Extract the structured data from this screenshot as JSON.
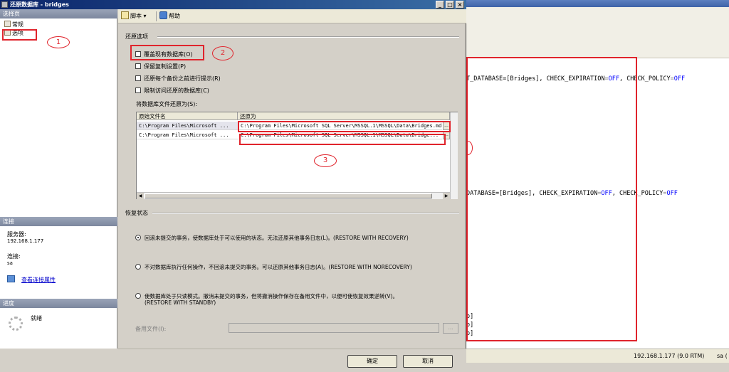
{
  "dialog": {
    "title": "还原数据库 - bridges",
    "minimize": "_",
    "maximize": "□",
    "close": "×"
  },
  "left_pane": {
    "select_page_header": "选择页",
    "pages": [
      {
        "label": "常规"
      },
      {
        "label": "选项"
      }
    ],
    "connection_header": "连接",
    "server_label": "服务器:",
    "server_value": "192.168.1.177",
    "connection_label": "连接:",
    "connection_value": "sa",
    "view_connection_link": "查看连接属性",
    "progress_header": "进度",
    "progress_status": "就绪"
  },
  "toolbar": {
    "script_label": "脚本",
    "script_arrow": "▾",
    "help_label": "帮助"
  },
  "restore_options": {
    "group_title": "还原选项",
    "checkboxes": [
      {
        "label": "覆盖现有数据库(O)",
        "checked": false
      },
      {
        "label": "保留复制设置(P)",
        "checked": false
      },
      {
        "label": "还原每个备份之前进行提示(R)",
        "checked": false
      },
      {
        "label": "限制访问还原的数据库(C)",
        "checked": false
      }
    ],
    "restore_files_label": "将数据库文件还原为(S):",
    "columns": [
      "原始文件名",
      "还原为"
    ],
    "rows": [
      {
        "original": "C:\\Program Files\\Microsoft ...",
        "restore_as": "C:\\Program Files\\Microsoft SQL Server\\MSSQL.1\\MSSQL\\Data\\Bridges.md"
      },
      {
        "original": "C:\\Program Files\\Microsoft ...",
        "restore_as": "C:\\Program Files\\Microsoft SQL Server\\MSSQL.1\\MSSQL\\Data\\Bridge..."
      }
    ],
    "browse_label": "..."
  },
  "recovery_state": {
    "group_title": "恢复状态",
    "options": [
      {
        "label": "回滚未提交的事务，使数据库处于可以使用的状态。无法还原其他事务日志(L)。(RESTORE WITH RECOVERY)",
        "line2": "",
        "selected": true
      },
      {
        "label": "不对数据库执行任何操作，不回滚未提交的事务。可以还原其他事务日志(A)。(RESTORE WITH NORECOVERY)",
        "line2": "",
        "selected": false
      },
      {
        "label": "使数据库处于只读模式。撤消未提交的事务，但将撤消操作保存在备用文件中，以便可使恢复效果逆转(V)。",
        "line2": "(RESTORE WITH STANDBY)",
        "selected": false
      }
    ],
    "standby_file_label": "备用文件(I):",
    "standby_file_value": "",
    "browse_label": "..."
  },
  "buttons": {
    "ok": "确定",
    "cancel": "取消"
  },
  "background_editor": {
    "lines": [
      {
        "pre": "T_DATABASE=[Bridges], CHECK_EXPIRATION",
        "eq": "=",
        "v1": "OFF",
        "mid": ", CHECK_POLICY",
        "eq2": "=",
        "v2": "OFF"
      },
      {
        "pre": "DATABASE=[Bridges], CHECK_EXPIRATION",
        "eq": "=",
        "v1": "OFF",
        "mid": ", CHECK_POLICY",
        "eq2": "=",
        "v2": "OFF"
      }
    ],
    "frag_a": "o]",
    "frag_b": "o]",
    "frag_c": "o]",
    "status_server": "192.168.1.177 (9.0 RTM)",
    "status_user": "sa ("
  },
  "annotations": {
    "n1": "1",
    "n2": "2",
    "n3": "3"
  },
  "colors": {
    "annotation_red": "#e0242c",
    "title_blue": "#0a246a",
    "keyword_blue": "#0000ff"
  }
}
